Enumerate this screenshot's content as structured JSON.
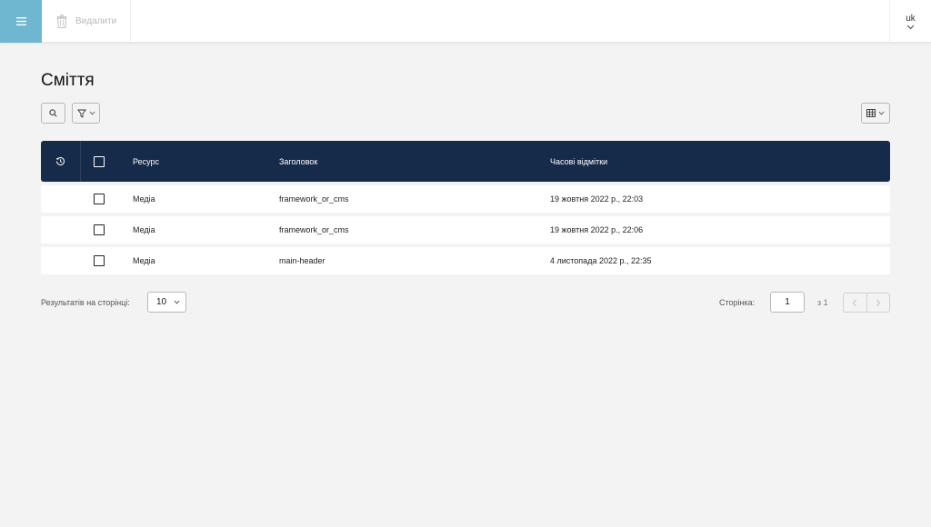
{
  "topbar": {
    "menu_icon": "hamburger-menu-icon",
    "delete_label": "Видалити",
    "delete_icon": "trash-icon",
    "language": "uk"
  },
  "page": {
    "title": "Сміття"
  },
  "toolbar": {
    "search_icon": "search-icon",
    "filter_icon": "filter-icon",
    "columns_icon": "columns-icon"
  },
  "table": {
    "headers": {
      "history_icon": "history-icon",
      "resource": "Ресурс",
      "title": "Заголовок",
      "timestamps": "Часові відмітки"
    },
    "rows": [
      {
        "resource": "Медіа",
        "title": "framework_or_cms",
        "timestamp": "19 жовтня 2022 р., 22:03"
      },
      {
        "resource": "Медіа",
        "title": "framework_or_cms",
        "timestamp": "19 жовтня 2022 р., 22:06"
      },
      {
        "resource": "Медіа",
        "title": "main-header",
        "timestamp": "4 листопада 2022 р., 22:35"
      }
    ]
  },
  "pagination": {
    "per_page_label": "Результатів на сторінці:",
    "per_page_value": "10",
    "page_label": "Сторінка:",
    "current_page": "1",
    "of_label": "з 1"
  },
  "colors": {
    "accent": "#6fb6d0",
    "table_header": "#162a4a",
    "background": "#f3f3f3"
  }
}
